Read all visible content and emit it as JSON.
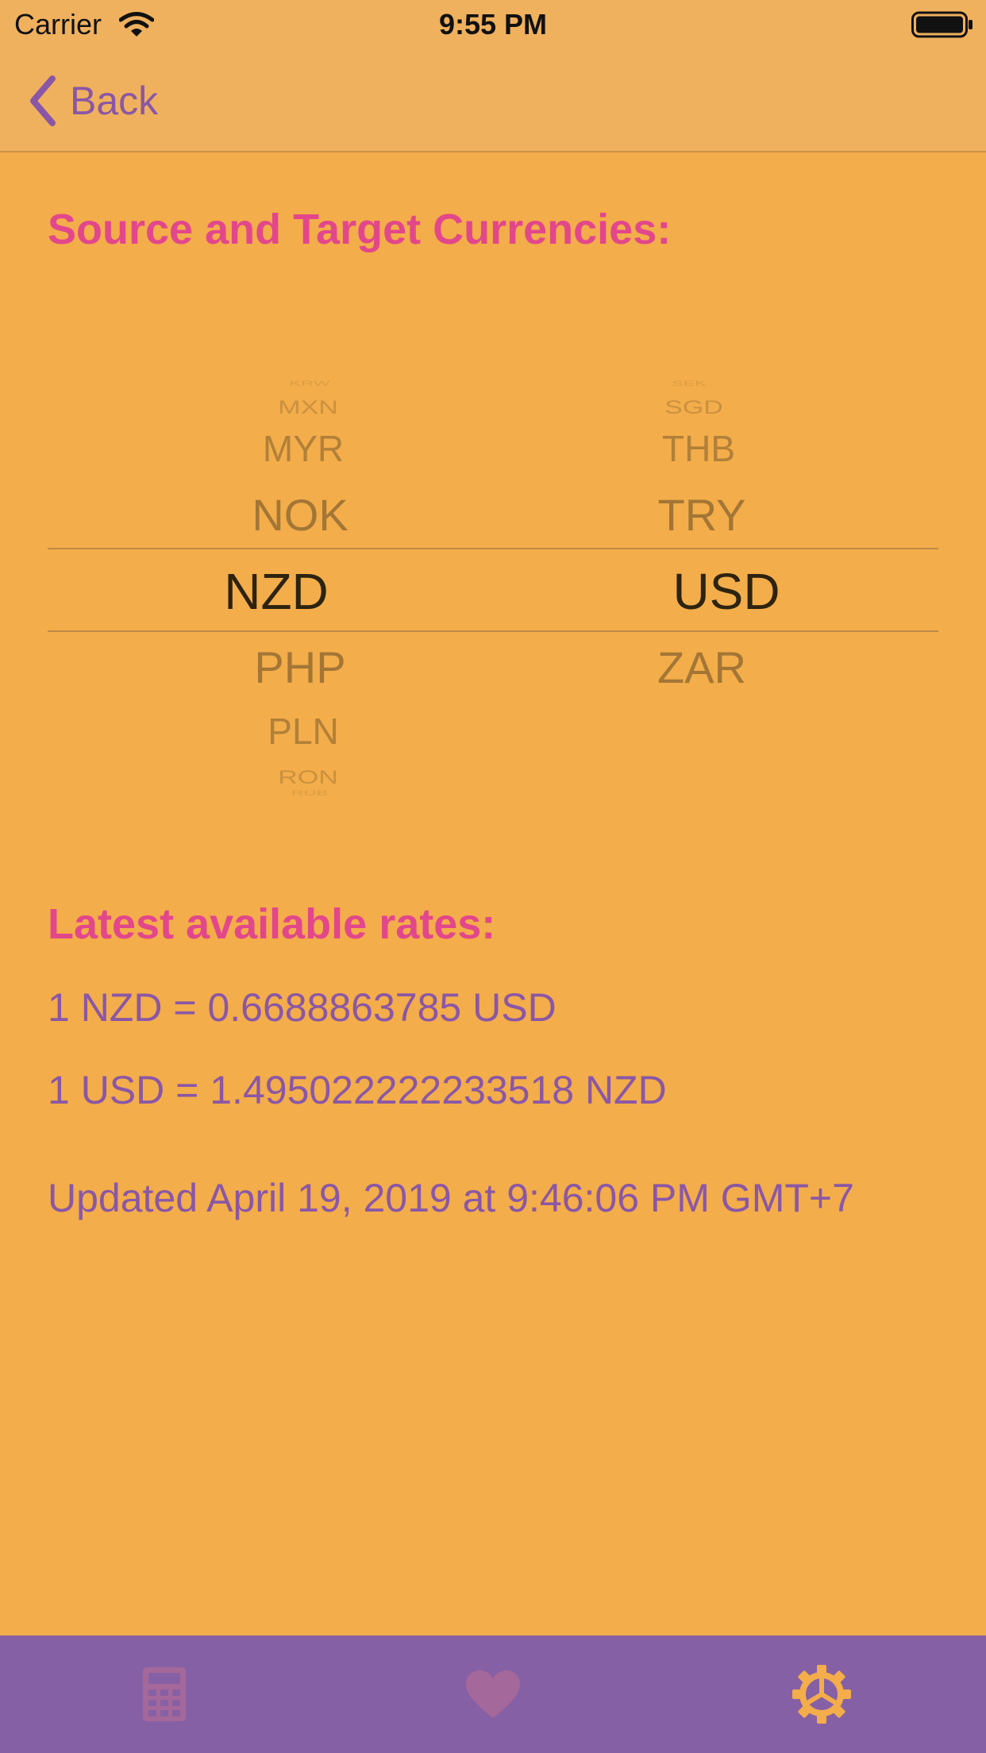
{
  "status_bar": {
    "carrier": "Carrier",
    "time": "9:55 PM"
  },
  "nav": {
    "back_label": "Back"
  },
  "titles": {
    "source_target": "Source and Target Currencies:",
    "latest_rates": "Latest available rates:"
  },
  "picker": {
    "left": {
      "above": [
        "KRW",
        "MXN",
        "MYR",
        "NOK"
      ],
      "selected": "NZD",
      "below": [
        "PHP",
        "PLN",
        "RON",
        "RUB"
      ]
    },
    "right": {
      "above": [
        "SEK",
        "SGD",
        "THB",
        "TRY"
      ],
      "selected": "USD",
      "below": [
        "ZAR"
      ]
    }
  },
  "rates": {
    "line1": "1 NZD = 0.6688863785 USD",
    "line2": "1 USD = 1.495022222233518 NZD",
    "updated": "Updated April 19, 2019 at 9:46:06 PM GMT+7"
  },
  "tabs": [
    {
      "icon": "calculator-icon",
      "selected": false
    },
    {
      "icon": "heart-icon",
      "selected": false
    },
    {
      "icon": "gear-icon",
      "selected": true
    }
  ],
  "colors": {
    "background": "#f3ad4a",
    "bar": "#efb15e",
    "accent_pink": "#e2478b",
    "accent_purple": "#8a57a6",
    "tabbar": "#8660a4",
    "tab_inactive": "#a5689a",
    "tab_active": "#f3ad4a"
  }
}
